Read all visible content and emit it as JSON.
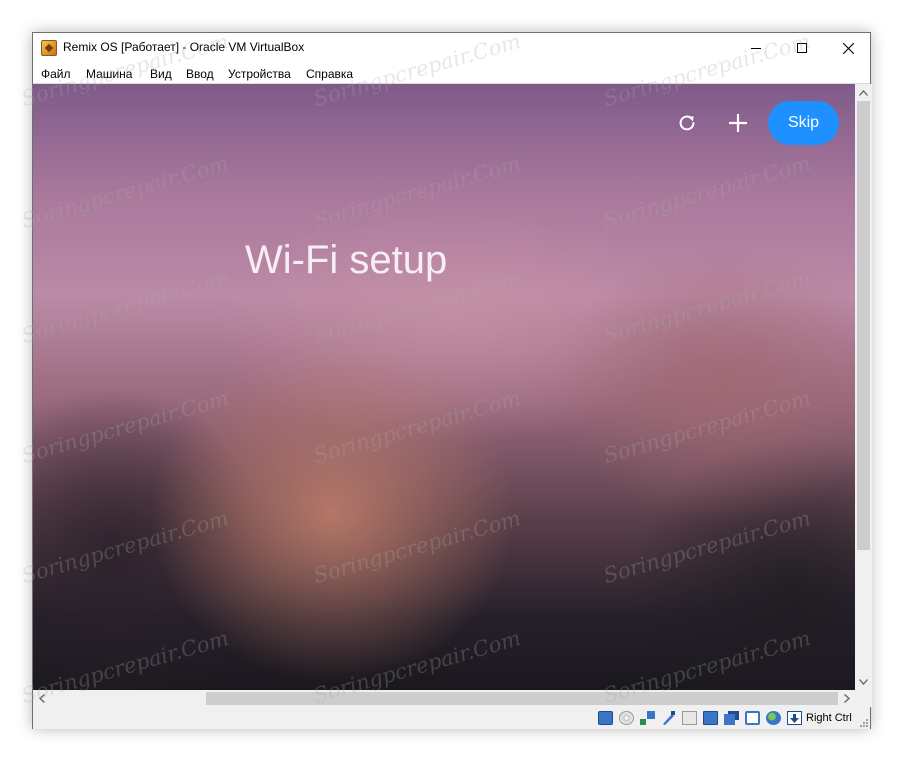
{
  "window": {
    "title": "Remix OS [Работает] - Oracle VM VirtualBox",
    "controls": [
      "minimize",
      "maximize",
      "close"
    ]
  },
  "menu": {
    "items": [
      "Файл",
      "Машина",
      "Вид",
      "Ввод",
      "Устройства",
      "Справка"
    ]
  },
  "guest": {
    "heading": "Wi-Fi setup",
    "refresh_icon": "refresh-icon",
    "add_icon": "plus-icon",
    "skip_label": "Skip",
    "skip_color": "#1e90ff"
  },
  "statusbar": {
    "icons": [
      "hard-disk-icon",
      "optical-drive-icon",
      "network-icon",
      "usb-icon",
      "shared-folders-icon",
      "display-icon",
      "video-capture-icon",
      "cpu-icon",
      "mouse-integration-icon",
      "keyboard-capture-icon"
    ],
    "host_key": "Right Ctrl"
  },
  "watermark": {
    "text": "Soringpcrepair.Com"
  }
}
